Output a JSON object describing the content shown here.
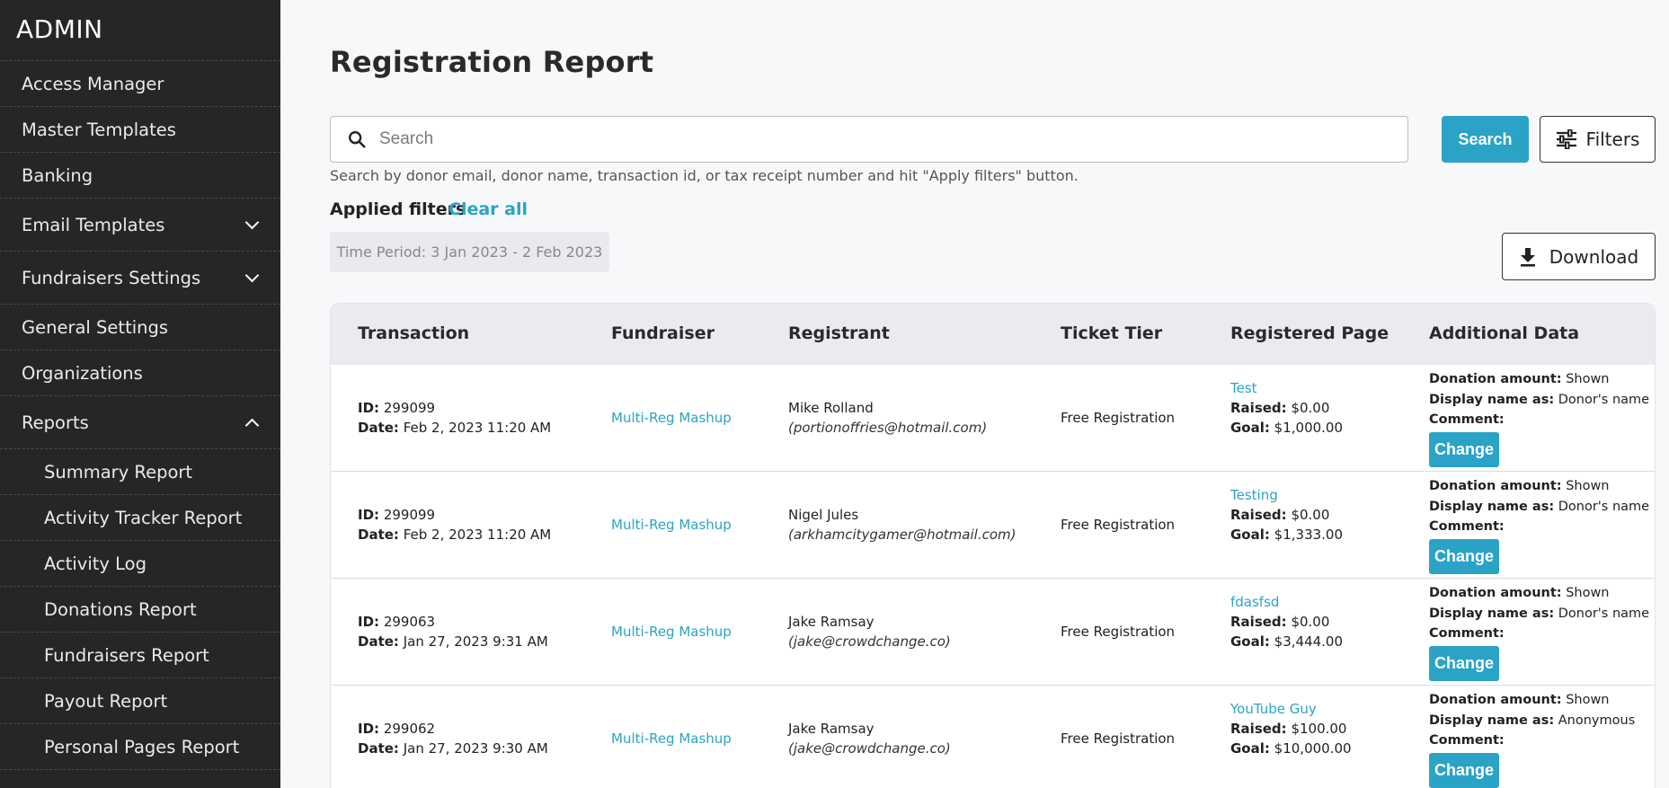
{
  "sidebar": {
    "brand": "ADMIN",
    "items": [
      {
        "label": "Access Manager"
      },
      {
        "label": "Master Templates"
      },
      {
        "label": "Banking"
      },
      {
        "label": "Email Templates"
      },
      {
        "label": "Fundraisers Settings"
      },
      {
        "label": "General Settings"
      },
      {
        "label": "Organizations"
      },
      {
        "label": "Reports"
      },
      {
        "label": "Summary Report"
      },
      {
        "label": "Activity Tracker Report"
      },
      {
        "label": "Activity Log"
      },
      {
        "label": "Donations Report"
      },
      {
        "label": "Fundraisers Report"
      },
      {
        "label": "Payout Report"
      },
      {
        "label": "Personal Pages Report"
      }
    ]
  },
  "main": {
    "title": "Registration Report",
    "search": {
      "placeholder": "Search",
      "value": "",
      "hint": "Search by donor email, donor name, transaction id, or tax receipt number and hit \"Apply filters\" button.",
      "button_label": "Search"
    },
    "filters_label": "Filters",
    "applied_filters_label": "Applied filters",
    "clear_all_label": "Clear all",
    "filter_chip": "Time Period: 3 Jan 2023 - 2 Feb 2023",
    "download_label": "Download"
  },
  "table": {
    "headers": [
      "Transaction",
      "Fundraiser",
      "Registrant",
      "Ticket Tier",
      "Registered Page",
      "Additional Data"
    ],
    "labels": {
      "id": "ID:",
      "date": "Date:",
      "raised": "Raised:",
      "goal": "Goal:",
      "donation_amount": "Donation amount:",
      "display_name_as": "Display name as:",
      "comment": "Comment:",
      "change": "Change"
    },
    "rows": [
      {
        "id": "299099",
        "date": "Feb 2, 2023 11:20 AM",
        "fundraiser": "Multi-Reg Mashup",
        "registrant_name": "Mike Rolland",
        "registrant_email": "(portionoffries@hotmail.com)",
        "ticket_tier": "Free Registration",
        "page_name": "Test",
        "raised": "$0.00",
        "goal": "$1,000.00",
        "donation_amount": "Shown",
        "display_name": "Donor's name",
        "comment": ""
      },
      {
        "id": "299099",
        "date": "Feb 2, 2023 11:20 AM",
        "fundraiser": "Multi-Reg Mashup",
        "registrant_name": "Nigel Jules",
        "registrant_email": "(arkhamcitygamer@hotmail.com)",
        "ticket_tier": "Free Registration",
        "page_name": "Testing",
        "raised": "$0.00",
        "goal": "$1,333.00",
        "donation_amount": "Shown",
        "display_name": "Donor's name",
        "comment": ""
      },
      {
        "id": "299063",
        "date": "Jan 27, 2023 9:31 AM",
        "fundraiser": "Multi-Reg Mashup",
        "registrant_name": "Jake Ramsay",
        "registrant_email": "(jake@crowdchange.co)",
        "ticket_tier": "Free Registration",
        "page_name": "fdasfsd",
        "raised": "$0.00",
        "goal": "$3,444.00",
        "donation_amount": "Shown",
        "display_name": "Donor's name",
        "comment": ""
      },
      {
        "id": "299062",
        "date": "Jan 27, 2023 9:30 AM",
        "fundraiser": "Multi-Reg Mashup",
        "registrant_name": "Jake Ramsay",
        "registrant_email": "(jake@crowdchange.co)",
        "ticket_tier": "Free Registration",
        "page_name": "YouTube Guy",
        "raised": "$100.00",
        "goal": "$10,000.00",
        "donation_amount": "Shown",
        "display_name": "Anonymous",
        "comment": ""
      }
    ]
  },
  "colors": {
    "accent": "#2aa3c6",
    "sidebar_bg": "#262626",
    "page_bg": "#f7f8fa"
  }
}
